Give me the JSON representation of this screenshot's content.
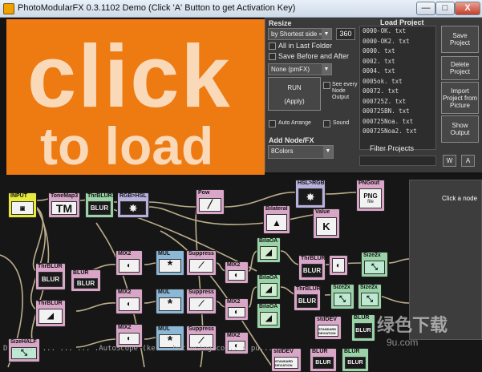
{
  "window": {
    "title": "PhotoModularFX 0.3.1102   Demo (Click 'A' Button to get Activation Key)",
    "min_label": "—",
    "max_label": "□",
    "close_label": "X"
  },
  "preview": {
    "line1": "click",
    "line2": "to load"
  },
  "panel": {
    "resize_label": "Resize",
    "resize_mode": "by Shortest side =",
    "resize_value": "360",
    "all_in_last_folder": "All in Last Folder",
    "save_before_after": "Save Before and After",
    "format_select": "None (pmFX)",
    "run_label": "RUN",
    "apply_label": "(Apply)",
    "see_every_node_output": "See every Node Output",
    "auto_arrange": "Auto Arrange",
    "sound": "Sound",
    "add_node_label": "Add Node/FX",
    "add_node_select": "8Colors",
    "load_project_label": "Load Project",
    "filter_projects_label": "Filter Projects",
    "files": [
      "0000-OK. txt",
      "0000-OK2. txt",
      "0000. txt",
      "0002. txt",
      "0004. txt",
      "0005ok. txt",
      "00072. txt",
      "000725Z. txt",
      "000725BN. txt",
      "000725Noa. txt",
      "000725Noa2. txt"
    ],
    "save_project": "Save Project",
    "delete_project": "Delete Project",
    "import_project": "Import Project from Picture",
    "show_output": "Show Output",
    "w_button": "W",
    "a_button": "A"
  },
  "graph": {
    "nodes": {
      "input": "INPUT",
      "tonemap": "ToneMap3",
      "thrblur3": "ThrBLUR3",
      "rgb_hsl": "RGB>HSL",
      "pow": "Pow",
      "hsl_rgb": "HSL>RGB",
      "pngout": "PNGout",
      "bilateral": "Bilateral",
      "value": "Value",
      "thrblur": "ThrBLUR",
      "blur": "BLUR",
      "mix2": "MIX2",
      "mul": "MUL",
      "suppress": "Suppress",
      "biloa": "BilaOA",
      "size2x": "Size2x",
      "stddev": "stdDEV",
      "sizehalf": "SizeHALF"
    },
    "icon_text": {
      "tm": "TM",
      "blur": "BLUR",
      "png": "PNG",
      "file": "file",
      "k": "K",
      "value": "Value",
      "star": "*",
      "stddev_sub": "STANDARD DEVIATION"
    },
    "side_label": "Click a node",
    "console": "D... ... ... ... ... .AutoScope (ke... but using co... s pu...",
    "watermark": "绿色下载",
    "watermark_sub": "9u.com"
  },
  "colors": {
    "preview_orange": "#ee7a12",
    "panel_bg": "#3a3a3a",
    "graph_bg": "#161616"
  }
}
